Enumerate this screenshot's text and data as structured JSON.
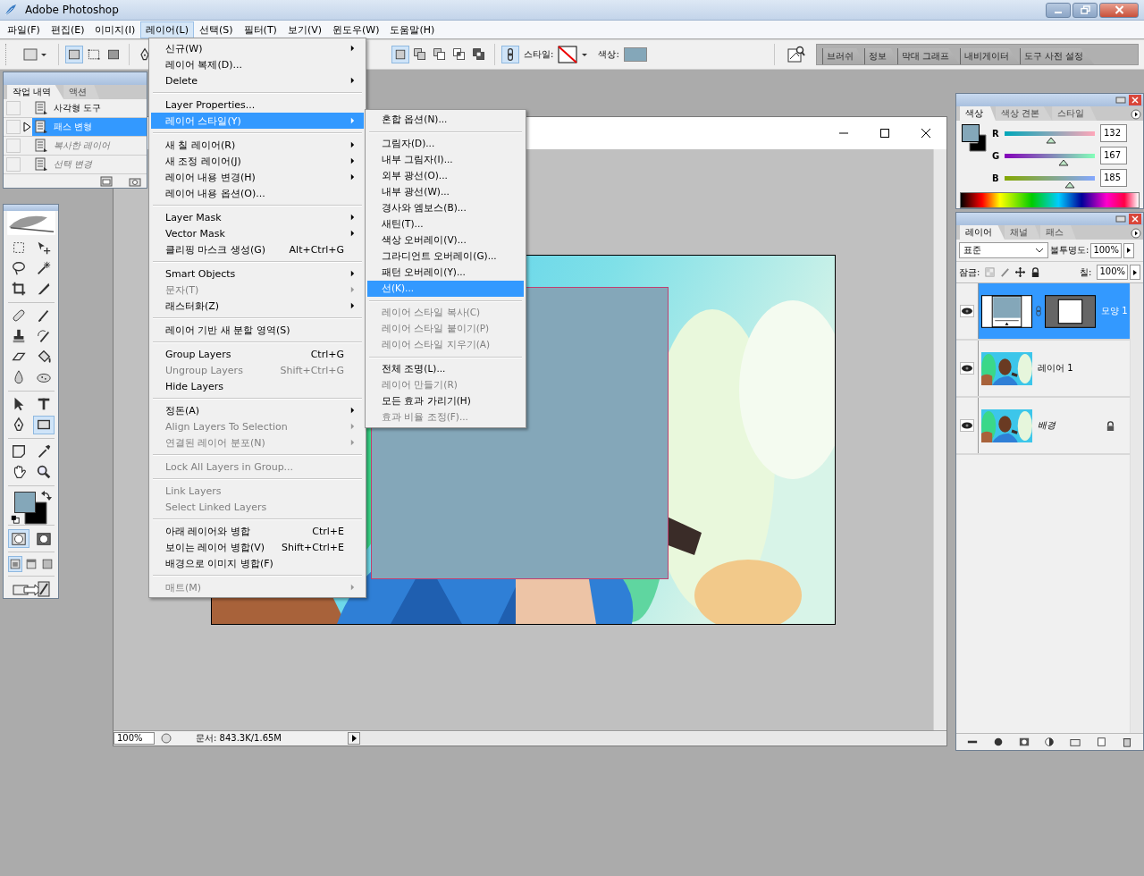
{
  "window": {
    "title": "Adobe Photoshop"
  },
  "menu_bar": [
    {
      "label": "파일(F)",
      "selected": false
    },
    {
      "label": "편집(E)",
      "selected": false
    },
    {
      "label": "이미지(I)",
      "selected": false
    },
    {
      "label": "레이어(L)",
      "selected": true
    },
    {
      "label": "선택(S)",
      "selected": false
    },
    {
      "label": "필터(T)",
      "selected": false
    },
    {
      "label": "보기(V)",
      "selected": false
    },
    {
      "label": "윈도우(W)",
      "selected": false
    },
    {
      "label": "도움말(H)",
      "selected": false
    }
  ],
  "options_bar": {
    "mode_buttons": [
      {
        "kind": "shape-layers",
        "selected": true
      },
      {
        "kind": "paths",
        "selected": false
      },
      {
        "kind": "fill-pixels",
        "selected": false
      }
    ],
    "combine_buttons": [
      {
        "kind": "new",
        "selected": true
      },
      {
        "kind": "add",
        "selected": false
      },
      {
        "kind": "subtract",
        "selected": false
      },
      {
        "kind": "intersect",
        "selected": false
      },
      {
        "kind": "exclude",
        "selected": false
      }
    ],
    "link_selected": true,
    "style_label": "스타일:",
    "color_label": "색상:",
    "palette_well": [
      {
        "label": "브러쉬"
      },
      {
        "label": "정보"
      },
      {
        "label": "막대 그래프"
      },
      {
        "label": "내비게이터"
      },
      {
        "label": "도구 사전 설정"
      }
    ]
  },
  "history_panel": {
    "tabs": [
      {
        "label": "작업 내역",
        "selected": true
      },
      {
        "label": "액션",
        "selected": false
      }
    ],
    "steps": [
      {
        "label": "사각형 도구",
        "selected": false,
        "disabled": false
      },
      {
        "label": "패스 변형",
        "selected": true,
        "disabled": false
      },
      {
        "label": "복사한 레이어",
        "selected": false,
        "disabled": true
      },
      {
        "label": "선택 변경",
        "selected": false,
        "disabled": true
      }
    ]
  },
  "toolbox": {
    "tool_groups": [
      [
        {
          "kind": "marquee",
          "selected": false
        },
        {
          "kind": "move",
          "selected": false
        },
        {
          "kind": "lasso",
          "selected": false
        },
        {
          "kind": "wand",
          "selected": false
        },
        {
          "kind": "crop",
          "selected": false
        },
        {
          "kind": "slice",
          "selected": false
        }
      ],
      [
        {
          "kind": "healing",
          "selected": false
        },
        {
          "kind": "brush",
          "selected": false
        },
        {
          "kind": "stamp",
          "selected": false
        },
        {
          "kind": "history-brush",
          "selected": false
        },
        {
          "kind": "eraser",
          "selected": false
        },
        {
          "kind": "bucket",
          "selected": false
        },
        {
          "kind": "blur",
          "selected": false
        },
        {
          "kind": "dodge",
          "selected": false
        }
      ],
      [
        {
          "kind": "path-select",
          "selected": false
        },
        {
          "kind": "type",
          "selected": false
        },
        {
          "kind": "pen",
          "selected": false
        },
        {
          "kind": "shape",
          "selected": true
        }
      ],
      [
        {
          "kind": "notes",
          "selected": false
        },
        {
          "kind": "eyedropper",
          "selected": false
        },
        {
          "kind": "hand",
          "selected": false
        },
        {
          "kind": "zoom",
          "selected": false
        }
      ]
    ],
    "mask_modes": [
      {
        "kind": "standard",
        "selected": true
      },
      {
        "kind": "quick-mask",
        "selected": false
      }
    ],
    "screen_modes": [
      {
        "kind": "standard",
        "selected": true
      },
      {
        "kind": "menu",
        "selected": false
      },
      {
        "kind": "full",
        "selected": false
      }
    ]
  },
  "layer_menu": {
    "sections": [
      [
        {
          "label": "신규(W)",
          "submenu": true,
          "disabled": false,
          "selected": false
        },
        {
          "label": "레이어 복제(D)...",
          "submenu": false,
          "disabled": false,
          "selected": false
        },
        {
          "label": "Delete",
          "submenu": true,
          "disabled": false,
          "selected": false
        }
      ],
      [
        {
          "label": "Layer Properties...",
          "submenu": false,
          "disabled": false,
          "selected": false
        },
        {
          "label": "레이어 스타일(Y)",
          "submenu": true,
          "disabled": false,
          "selected": true
        }
      ],
      [
        {
          "label": "새 칠 레이어(R)",
          "submenu": true,
          "disabled": false,
          "selected": false
        },
        {
          "label": "새 조정 레이어(J)",
          "submenu": true,
          "disabled": false,
          "selected": false
        },
        {
          "label": "레이어 내용 변경(H)",
          "submenu": true,
          "disabled": false,
          "selected": false
        },
        {
          "label": "레이어 내용 옵션(O)...",
          "submenu": false,
          "disabled": false,
          "selected": false
        }
      ],
      [
        {
          "label": "Layer Mask",
          "submenu": true,
          "disabled": false,
          "selected": false
        },
        {
          "label": "Vector Mask",
          "submenu": true,
          "disabled": false,
          "selected": false
        },
        {
          "label": "클리핑 마스크 생성(G)",
          "shortcut": "Alt+Ctrl+G",
          "submenu": false,
          "disabled": false,
          "selected": false
        }
      ],
      [
        {
          "label": "Smart Objects",
          "submenu": true,
          "disabled": false,
          "selected": false
        },
        {
          "label": "문자(T)",
          "submenu": true,
          "disabled": true,
          "selected": false
        },
        {
          "label": "래스터화(Z)",
          "submenu": true,
          "disabled": false,
          "selected": false
        }
      ],
      [
        {
          "label": "레이어 기반 새 분할 영역(S)",
          "submenu": false,
          "disabled": false,
          "selected": false
        }
      ],
      [
        {
          "label": "Group Layers",
          "shortcut": "Ctrl+G",
          "submenu": false,
          "disabled": false,
          "selected": false
        },
        {
          "label": "Ungroup Layers",
          "shortcut": "Shift+Ctrl+G",
          "submenu": false,
          "disabled": true,
          "selected": false
        },
        {
          "label": "Hide Layers",
          "submenu": false,
          "disabled": false,
          "selected": false
        }
      ],
      [
        {
          "label": "정돈(A)",
          "submenu": true,
          "disabled": false,
          "selected": false
        },
        {
          "label": "Align Layers To Selection",
          "submenu": true,
          "disabled": true,
          "selected": false
        },
        {
          "label": "연결된 레이어 분포(N)",
          "submenu": true,
          "disabled": true,
          "selected": false
        }
      ],
      [
        {
          "label": "Lock All Layers in Group...",
          "submenu": false,
          "disabled": true,
          "selected": false
        }
      ],
      [
        {
          "label": "Link Layers",
          "submenu": false,
          "disabled": true,
          "selected": false
        },
        {
          "label": "Select Linked Layers",
          "submenu": false,
          "disabled": true,
          "selected": false
        }
      ],
      [
        {
          "label": "아래 레이어와 병합",
          "shortcut": "Ctrl+E",
          "submenu": false,
          "disabled": false,
          "selected": false
        },
        {
          "label": "보이는 레이어 병합(V)",
          "shortcut": "Shift+Ctrl+E",
          "submenu": false,
          "disabled": false,
          "selected": false
        },
        {
          "label": "배경으로 이미지 병합(F)",
          "submenu": false,
          "disabled": false,
          "selected": false
        }
      ],
      [
        {
          "label": "매트(M)",
          "submenu": true,
          "disabled": true,
          "selected": false
        }
      ]
    ]
  },
  "style_submenu": {
    "sections": [
      [
        {
          "label": "혼합 옵션(N)...",
          "disabled": false,
          "selected": false
        }
      ],
      [
        {
          "label": "그림자(D)...",
          "disabled": false,
          "selected": false
        },
        {
          "label": "내부 그림자(I)...",
          "disabled": false,
          "selected": false
        },
        {
          "label": "외부 광선(O)...",
          "disabled": false,
          "selected": false
        },
        {
          "label": "내부 광선(W)...",
          "disabled": false,
          "selected": false
        },
        {
          "label": "경사와 엠보스(B)...",
          "disabled": false,
          "selected": false
        },
        {
          "label": "새틴(T)...",
          "disabled": false,
          "selected": false
        },
        {
          "label": "색상 오버레이(V)...",
          "disabled": false,
          "selected": false
        },
        {
          "label": "그라디언트 오버레이(G)...",
          "disabled": false,
          "selected": false
        },
        {
          "label": "패턴 오버레이(Y)...",
          "disabled": false,
          "selected": false
        },
        {
          "label": "선(K)...",
          "disabled": false,
          "selected": true
        }
      ],
      [
        {
          "label": "레이어 스타일 복사(C)",
          "disabled": true,
          "selected": false
        },
        {
          "label": "레이어 스타일 붙이기(P)",
          "disabled": true,
          "selected": false
        },
        {
          "label": "레이어 스타일 지우기(A)",
          "disabled": true,
          "selected": false
        }
      ],
      [
        {
          "label": "전체 조명(L)...",
          "disabled": false,
          "selected": false
        },
        {
          "label": "레이어 만들기(R)",
          "disabled": true,
          "selected": false
        },
        {
          "label": "모든 효과 가리기(H)",
          "disabled": false,
          "selected": false
        },
        {
          "label": "효과 비율 조정(F)...",
          "disabled": true,
          "selected": false
        }
      ]
    ]
  },
  "document": {
    "zoom": "100%",
    "info": "문서: 843.3K/1.65M"
  },
  "color_panel": {
    "tabs": [
      {
        "label": "색상",
        "selected": true
      },
      {
        "label": "색상 견본",
        "selected": false
      },
      {
        "label": "스타일",
        "selected": false
      }
    ],
    "channels": [
      {
        "name": "R",
        "level": 0.518,
        "value": "132"
      },
      {
        "name": "G",
        "level": 0.655,
        "value": "167"
      },
      {
        "name": "B",
        "level": 0.725,
        "value": "185"
      }
    ]
  },
  "layers_panel": {
    "tabs": [
      {
        "label": "레이어",
        "selected": true
      },
      {
        "label": "채널",
        "selected": false
      },
      {
        "label": "패스",
        "selected": false
      }
    ],
    "blend_mode": "표준",
    "opacity_label": "불투명도:",
    "opacity": "100%",
    "lock_label": "잠금:",
    "fill_label": "칠:",
    "fill": "100%",
    "layers": [
      {
        "name": "모양 1",
        "kind": "shape",
        "selected": true,
        "visible": true,
        "locked": false
      },
      {
        "name": "레이어 1",
        "selected": false,
        "visible": true,
        "locked": false
      },
      {
        "name": "배경",
        "kind": "background",
        "selected": false,
        "visible": true,
        "locked": true
      }
    ]
  }
}
